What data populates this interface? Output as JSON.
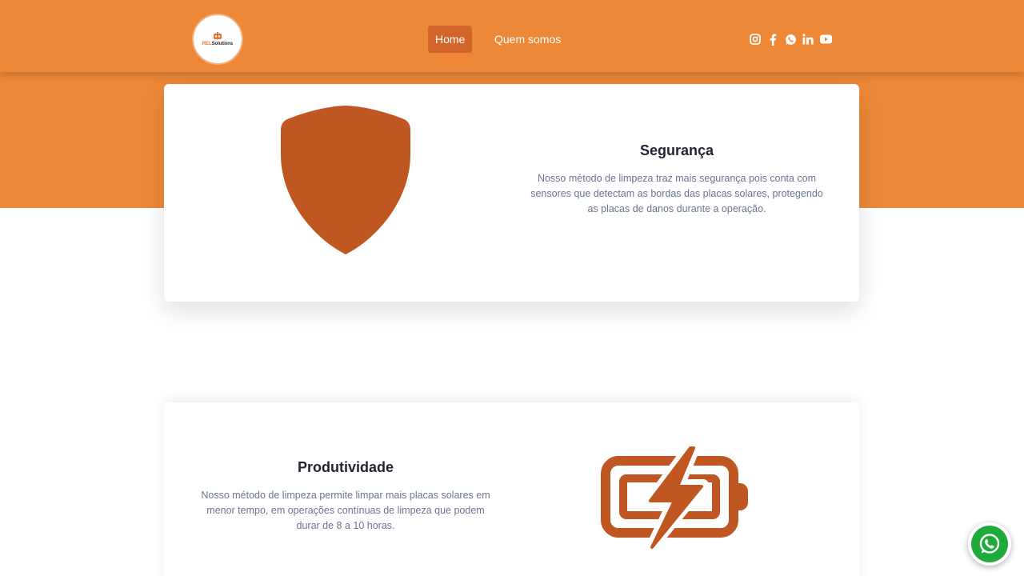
{
  "colors": {
    "brand_orange": "#ed8838",
    "nav_active": "#d4652a",
    "icon_rust": "#c05621",
    "whatsapp_green": "#1faa3c"
  },
  "header": {
    "logo_text_highlight": "REL",
    "logo_text_rest": "Solutions",
    "nav": {
      "home": "Home",
      "about": "Quem somos"
    },
    "social_icons": [
      "instagram-icon",
      "facebook-icon",
      "whatsapp-icon",
      "linkedin-icon",
      "youtube-icon"
    ]
  },
  "features": [
    {
      "title": "Segurança",
      "text": "Nosso método de limpeza traz mais segurança pois conta com sensores que detectam as bordas das placas solares, protegendo as placas de danos durante a operação.",
      "icon": "shield-icon"
    },
    {
      "title": "Produtividade",
      "text": "Nosso método de limpeza permite limpar mais placas solares em menor tempo, em operações contínuas de limpeza que podem durar de 8 a 10 horas.",
      "icon": "battery-bolt-icon"
    }
  ],
  "floating": {
    "icon": "whatsapp-icon"
  }
}
